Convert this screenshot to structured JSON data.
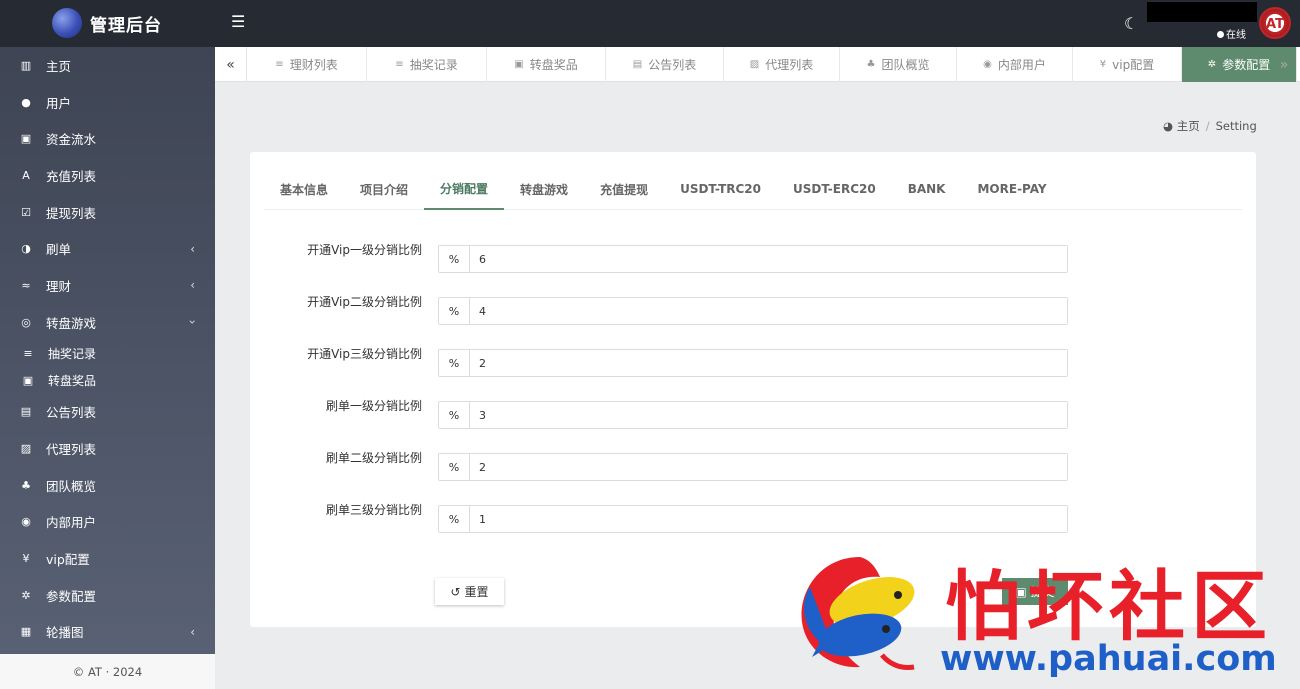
{
  "app": {
    "title": "管理后台"
  },
  "sidebar": {
    "items": [
      {
        "label": "主页",
        "icon": "bar-chart-icon"
      },
      {
        "label": "用户",
        "icon": "user-icon"
      },
      {
        "label": "资金流水",
        "icon": "money-icon"
      },
      {
        "label": "充值列表",
        "icon": "recharge-icon"
      },
      {
        "label": "提现列表",
        "icon": "check-square-icon"
      },
      {
        "label": "刷单",
        "icon": "half-circle-icon",
        "arrow": "‹"
      },
      {
        "label": "理财",
        "icon": "finance-icon",
        "arrow": "‹"
      },
      {
        "label": "转盘游戏",
        "icon": "gamepad-icon",
        "arrow": "›"
      },
      {
        "label": "抽奖记录",
        "icon": "list-icon",
        "sub": true
      },
      {
        "label": "转盘奖品",
        "icon": "money-icon",
        "sub": true
      },
      {
        "label": "公告列表",
        "icon": "file-icon"
      },
      {
        "label": "代理列表",
        "icon": "contact-icon"
      },
      {
        "label": "团队概览",
        "icon": "users-icon"
      },
      {
        "label": "内部用户",
        "icon": "user-circle-icon"
      },
      {
        "label": "vip配置",
        "icon": "vip-icon"
      },
      {
        "label": "参数配置",
        "icon": "gears-icon"
      },
      {
        "label": "轮播图",
        "icon": "image-icon",
        "arrow": "‹"
      }
    ],
    "footer": "© AT · 2024"
  },
  "topbar": {
    "online_label": "在线"
  },
  "tabs": [
    {
      "label": "理财列表",
      "icon": "list-icon"
    },
    {
      "label": "抽奖记录",
      "icon": "list-icon"
    },
    {
      "label": "转盘奖品",
      "icon": "money-icon"
    },
    {
      "label": "公告列表",
      "icon": "file-icon"
    },
    {
      "label": "代理列表",
      "icon": "contact-icon"
    },
    {
      "label": "团队概览",
      "icon": "users-icon"
    },
    {
      "label": "内部用户",
      "icon": "user-circle-icon"
    },
    {
      "label": "vip配置",
      "icon": "vip-icon"
    },
    {
      "label": "参数配置",
      "icon": "gears-icon",
      "active": true
    }
  ],
  "breadcrumb": {
    "home": "主页",
    "current": "Setting"
  },
  "subtabs": [
    {
      "label": "基本信息"
    },
    {
      "label": "项目介绍"
    },
    {
      "label": "分销配置",
      "active": true
    },
    {
      "label": "转盘游戏"
    },
    {
      "label": "充值提现"
    },
    {
      "label": "USDT-TRC20"
    },
    {
      "label": "USDT-ERC20"
    },
    {
      "label": "BANK"
    },
    {
      "label": "MORE-PAY"
    }
  ],
  "form": {
    "addon": "%",
    "rows": [
      {
        "label": "开通Vip一级分销比例",
        "value": "6"
      },
      {
        "label": "开通Vip二级分销比例",
        "value": "4"
      },
      {
        "label": "开通Vip三级分销比例",
        "value": "2"
      },
      {
        "label": "刷单一级分销比例",
        "value": "3"
      },
      {
        "label": "刷单二级分销比例",
        "value": "2"
      },
      {
        "label": "刷单三级分销比例",
        "value": "1"
      }
    ],
    "reset_label": "重置",
    "submit_label": "提交"
  },
  "watermark": {
    "text": "怕坏社区",
    "url": "www.pahuai.com"
  },
  "colors": {
    "accent": "#5e8b6e",
    "topbar": "#262a33",
    "watermark_red": "#e8202a",
    "watermark_blue": "#1f5fc8"
  }
}
